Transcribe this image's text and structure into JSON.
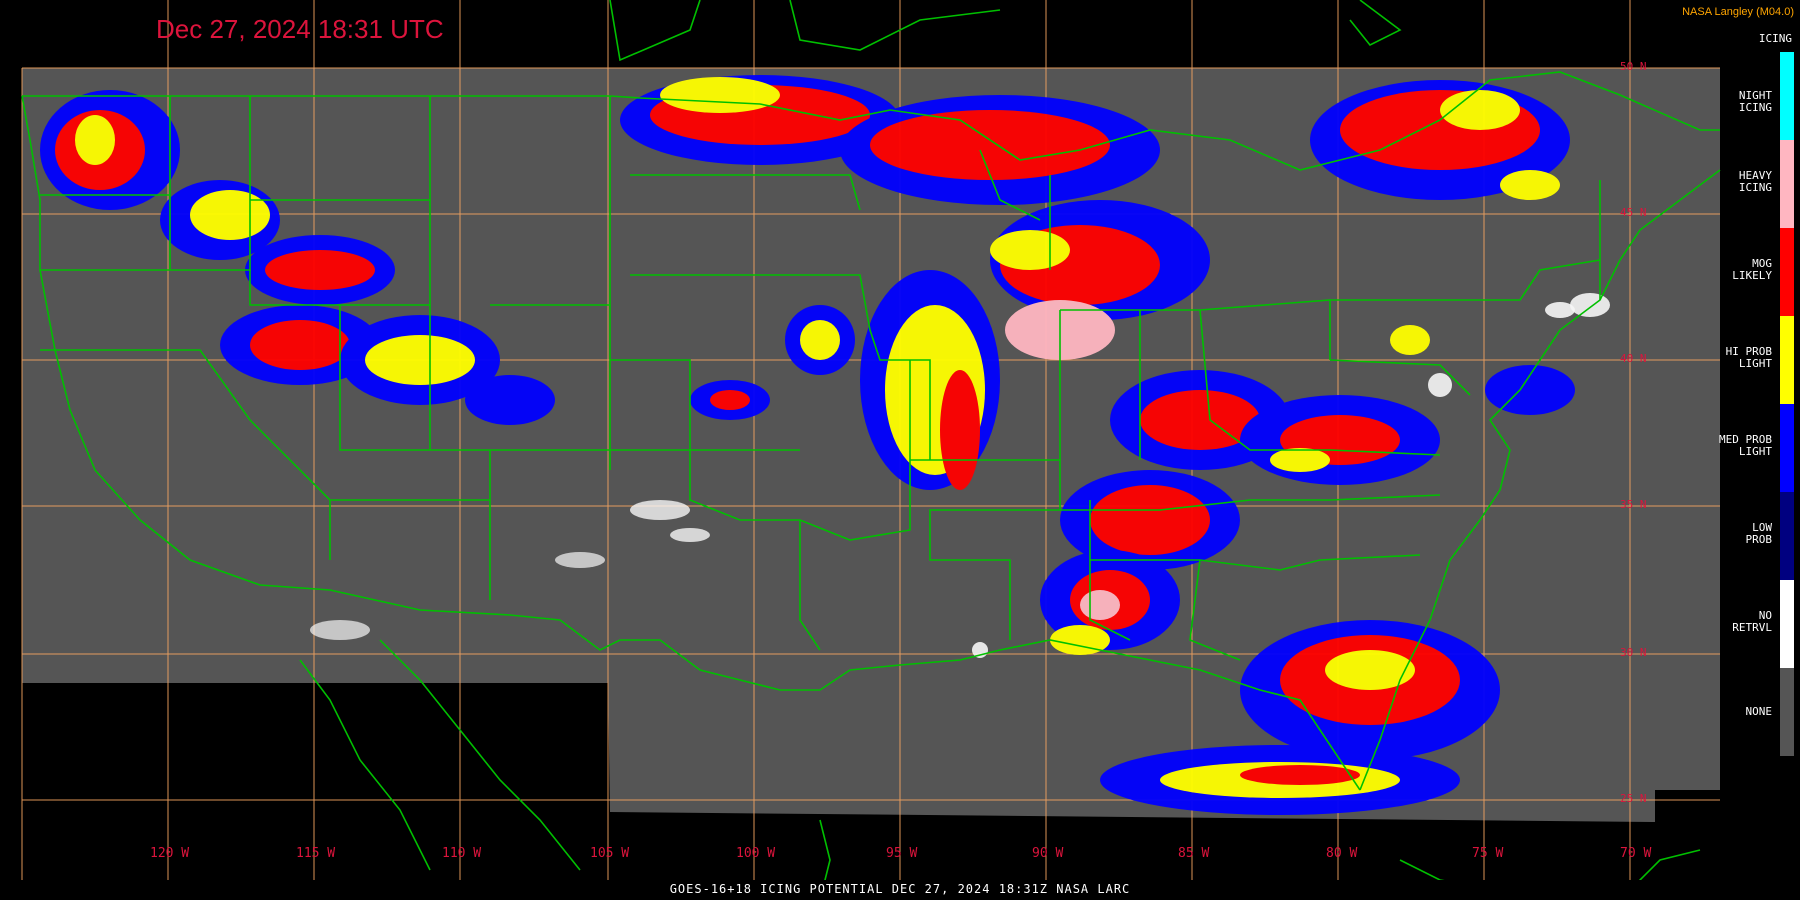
{
  "header": {
    "timestamp": "Dec 27, 2024 18:31 UTC",
    "credit": "NASA Langley (M04.0)"
  },
  "footer": {
    "caption": "GOES-16+18  ICING POTENTIAL  DEC 27, 2024 18:31Z  NASA LARC"
  },
  "map": {
    "longitude_labels": [
      "120 W",
      "115 W",
      "110 W",
      "105 W",
      "100 W",
      "95 W",
      "90 W",
      "85 W",
      "80 W",
      "75 W",
      "70 W"
    ],
    "latitude_labels": [
      "50 N",
      "45 N",
      "40 N",
      "35 N",
      "30 N",
      "25 N"
    ],
    "colors": {
      "background": "#000000",
      "no_data_gray": "#555555",
      "graticule": "#f4a460",
      "borders": "#00c000",
      "title": "#dc143c"
    }
  },
  "legend": {
    "heading": "ICING",
    "items": [
      {
        "label": "NIGHT ICING",
        "color": "#00ffff"
      },
      {
        "label": "HEAVY ICING",
        "color": "#ffb6c1"
      },
      {
        "label": "MOG LIKELY",
        "color": "#ff0000"
      },
      {
        "label": "HI PROB LIGHT",
        "color": "#ffff00"
      },
      {
        "label": "MED PROB LIGHT",
        "color": "#0000ff"
      },
      {
        "label": "LOW PROB",
        "color": "#000080"
      },
      {
        "label": "NO RETRVL",
        "color": "#ffffff"
      },
      {
        "label": "NONE",
        "color": "#555555"
      }
    ]
  }
}
